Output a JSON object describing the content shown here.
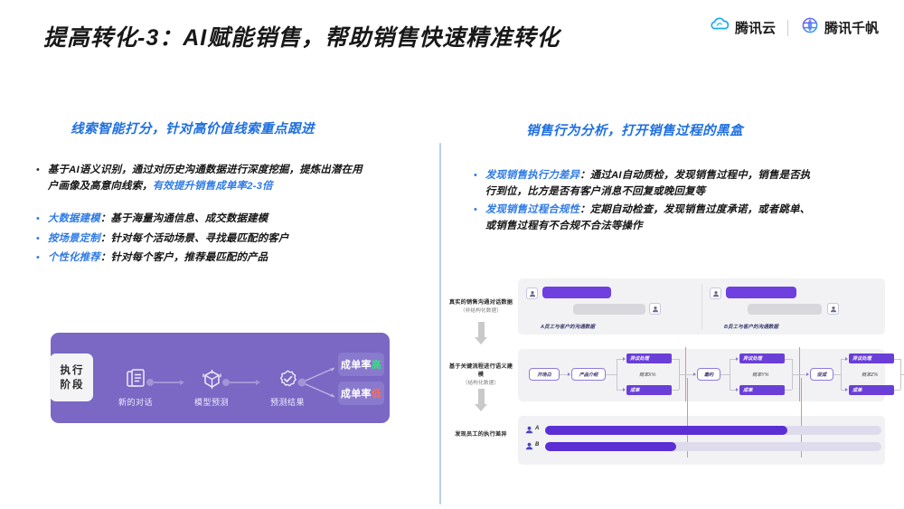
{
  "header": {
    "title": "提高转化-3：AI赋能销售，帮助销售快速精准转化",
    "brands": [
      {
        "name": "腾讯云",
        "icon": "tencent-cloud-icon"
      },
      {
        "name": "腾讯千帆",
        "icon": "tencent-qianfan-icon"
      }
    ]
  },
  "left": {
    "heading": "线索智能打分，针对高价值线索重点跟进",
    "bullet_marker": "•",
    "paragraph": {
      "plain_1": "基于AI语义识别，通过对历史沟通数据进行深度挖掘，提炼出潜在用户画像及高意向线索，",
      "highlight": "有效提升销售成单率2-3倍"
    },
    "items": [
      {
        "term": "大数据建模",
        "colon": "：",
        "desc": "基于海量沟通信息、成交数据建模"
      },
      {
        "term": "按场景定制",
        "colon": "：",
        "desc": "针对每个活动场景、寻找最匹配的客户"
      },
      {
        "term": "个性化推荐",
        "colon": "：",
        "desc": "针对每个客户，推荐最匹配的产品"
      }
    ],
    "flow_card": {
      "stage_chip": [
        "执行",
        "阶段"
      ],
      "steps": [
        {
          "icon": "documents-icon",
          "label": "新的对话"
        },
        {
          "icon": "cube-model-icon",
          "label": "模型预测"
        },
        {
          "icon": "check-badge-icon",
          "label": "预测结果"
        }
      ],
      "outcomes": [
        {
          "prefix": "成单率",
          "mark": "高",
          "tone": "#35dd7f"
        },
        {
          "prefix": "成单率",
          "mark": "低",
          "tone": "#ff6a4d"
        }
      ]
    }
  },
  "right": {
    "heading": "销售行为分析，打开销售过程的黑盒",
    "bullet_marker": "•",
    "items": [
      {
        "term": "发现销售执行力差异",
        "colon": "：",
        "desc": "通过AI自动质检，发现销售过程中，销售是否执行到位，比方是否有客户消息不回复或晚回复等"
      },
      {
        "term": "发现销售过程合规性",
        "colon": "：",
        "desc": "定期自动检查，发现销售过度承诺，或者跳单、或销售过程有不合规不合法等操作"
      }
    ],
    "diagram": {
      "stages": [
        {
          "title": "真实的销售沟通对话数据",
          "sub": "（非结构化数据）"
        },
        {
          "title": "基于关键流程进行语义建模",
          "sub": "（结构化数据）"
        },
        {
          "title": "发现员工的执行差异",
          "sub": ""
        }
      ],
      "chat_panel": {
        "captions": [
          "A员工与客户的沟通数据",
          "B员工与客户的沟通数据"
        ],
        "avatar_icon": "user-square-icon"
      },
      "flow_panel": {
        "start_nodes": [
          "开场白",
          "产品介绍"
        ],
        "mid_nodes": [
          "邀约",
          "促成"
        ],
        "groups": [
          {
            "top": "异议处理",
            "prob": "概率X%",
            "bottom": "成单"
          },
          {
            "top": "异议处理",
            "prob": "概率Y%",
            "bottom": "成单"
          },
          {
            "top": "异议处理",
            "prob": "概率Z%",
            "bottom": "成单"
          }
        ]
      },
      "bars_panel": {
        "rows": [
          {
            "label": "A",
            "icon": "person-icon",
            "percent": 72
          },
          {
            "label": "B",
            "icon": "person-icon",
            "percent": 39
          }
        ]
      }
    }
  },
  "colors": {
    "accent_blue": "#2f7ae5",
    "purple_card": "#7a68c4",
    "purple_bar": "#6a3fd8",
    "panel_grey": "#f2f2f4",
    "divider_blue": "#b9cfe8"
  }
}
